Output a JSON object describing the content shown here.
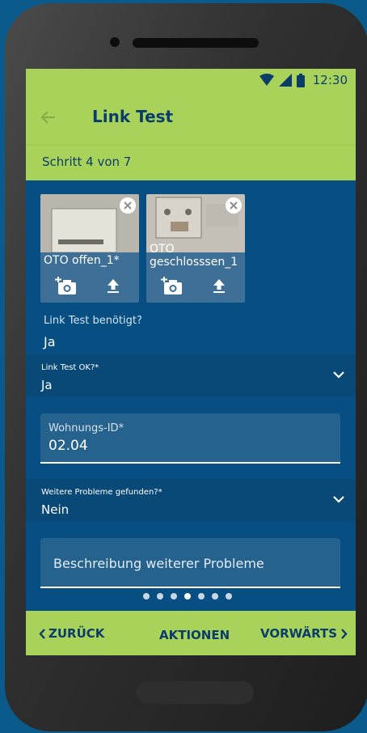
{
  "status_bar": {
    "time": "12:30"
  },
  "app_bar": {
    "title": "Link Test"
  },
  "step": {
    "text": "Schritt 4 von 7"
  },
  "photos": [
    {
      "caption": "OTO offen_1*"
    },
    {
      "caption": "OTO geschlosssen_1"
    }
  ],
  "link_test_needed": {
    "label": "Link Test benötigt?",
    "value": "Ja"
  },
  "link_test_ok": {
    "label": "Link Test OK?*",
    "value": "Ja"
  },
  "apartment_id": {
    "label": "Wohnungs-ID*",
    "value": "02.04"
  },
  "further_problems": {
    "label": "Weitere Probleme gefunden?*",
    "value": "Nein"
  },
  "problem_description": {
    "placeholder": "Beschreibung weiterer Probleme"
  },
  "pager": {
    "total": 7,
    "active": 4
  },
  "bottom_bar": {
    "back_label": "ZURÜCK",
    "actions_label": "AKTIONEN",
    "forward_label": "VORWÄRTS"
  },
  "colors": {
    "accent": "#a8d25a",
    "primary": "#074f82",
    "text_dark": "#0b3d6b"
  },
  "icons": [
    "back-arrow-icon",
    "wifi-icon",
    "signal-icon",
    "battery-icon",
    "close-icon",
    "add-photo-icon",
    "upload-icon",
    "chevron-down-icon",
    "chevron-left-icon",
    "chevron-right-icon"
  ]
}
